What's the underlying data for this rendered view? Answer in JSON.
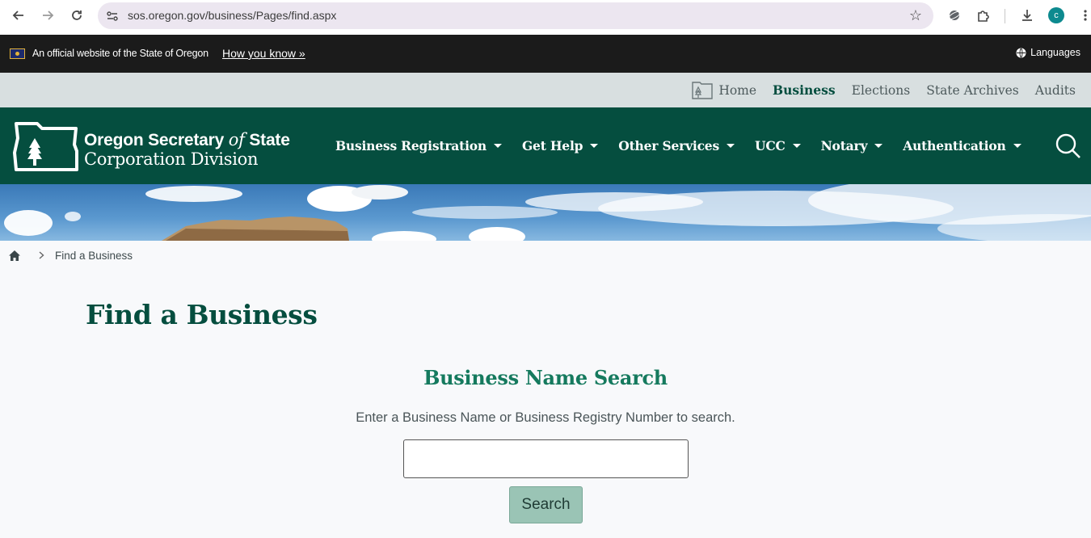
{
  "browser": {
    "url": "sos.oregon.gov/business/Pages/find.aspx",
    "profile_initial": "c",
    "icons": [
      "back-arrow-icon",
      "forward-arrow-icon",
      "reload-icon",
      "site-settings-icon",
      "bookmark-star-icon",
      "extension-icon",
      "puzzle-icon",
      "download-icon",
      "avatar",
      "menu-dots-icon"
    ]
  },
  "banner": {
    "official_text": "An official website of the State of Oregon",
    "how_link": "How you know »",
    "languages": "Languages"
  },
  "utility_nav": {
    "home": "Home",
    "business": "Business",
    "elections": "Elections",
    "archives": "State Archives",
    "audits": "Audits"
  },
  "header": {
    "logo_line1_a": "Oregon Secretary ",
    "logo_line1_of": "of",
    "logo_line1_b": " State",
    "logo_line2": "Corporation Division",
    "nav": [
      "Business Registration",
      "Get Help",
      "Other Services",
      "UCC",
      "Notary",
      "Authentication"
    ]
  },
  "breadcrumb": {
    "current": "Find a Business"
  },
  "main": {
    "title": "Find a Business",
    "section_title": "Business Name Search",
    "instructions": "Enter a Business Name or Business Registry Number to search.",
    "search_value": "",
    "search_button": "Search"
  },
  "colors": {
    "brand_green": "#054e3f",
    "accent_green": "#157a5e",
    "button_green": "#9ac4b5",
    "banner_black": "#1b1b1b",
    "utility_bg": "#d8dfe0"
  }
}
